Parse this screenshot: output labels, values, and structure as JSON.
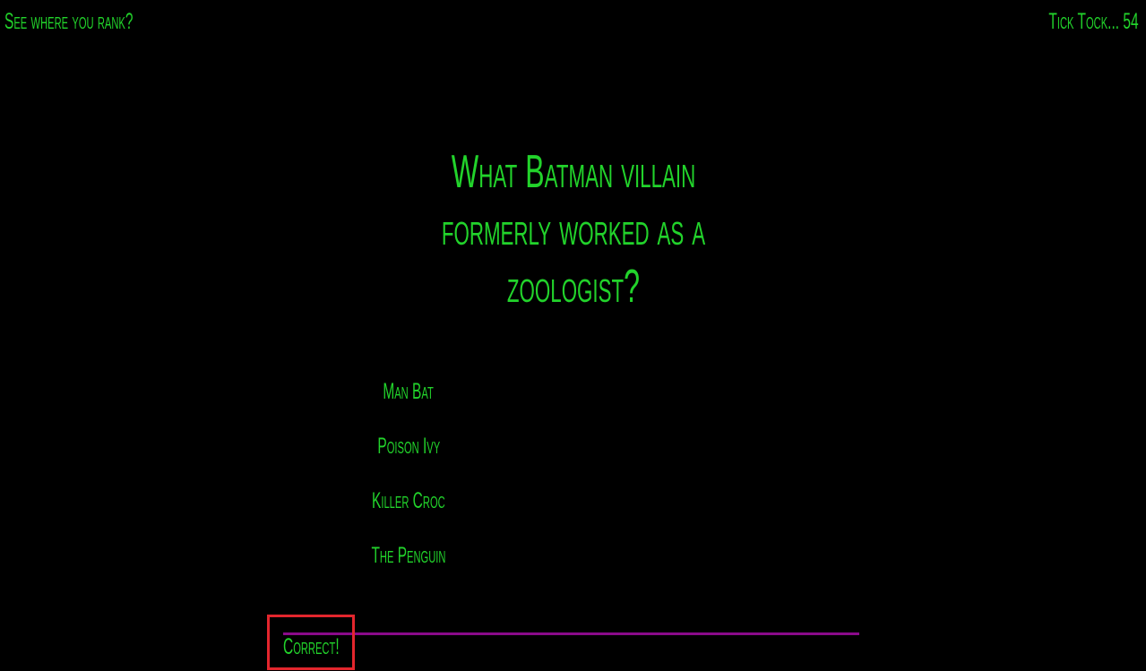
{
  "header": {
    "rank_link": "See where you rank?",
    "timer": "Tick Tock... 54"
  },
  "quiz": {
    "question": "What Batman villain formerly worked as a zoologist?",
    "answers": [
      {
        "label": "Man Bat"
      },
      {
        "label": "Poison Ivy"
      },
      {
        "label": "Killer Croc"
      },
      {
        "label": "The Penguin"
      }
    ],
    "feedback": "Correct!"
  },
  "colors": {
    "background": "#000000",
    "text": "#22d32b",
    "progress_line": "#8a0a8a",
    "highlight_box": "#e3262d"
  }
}
